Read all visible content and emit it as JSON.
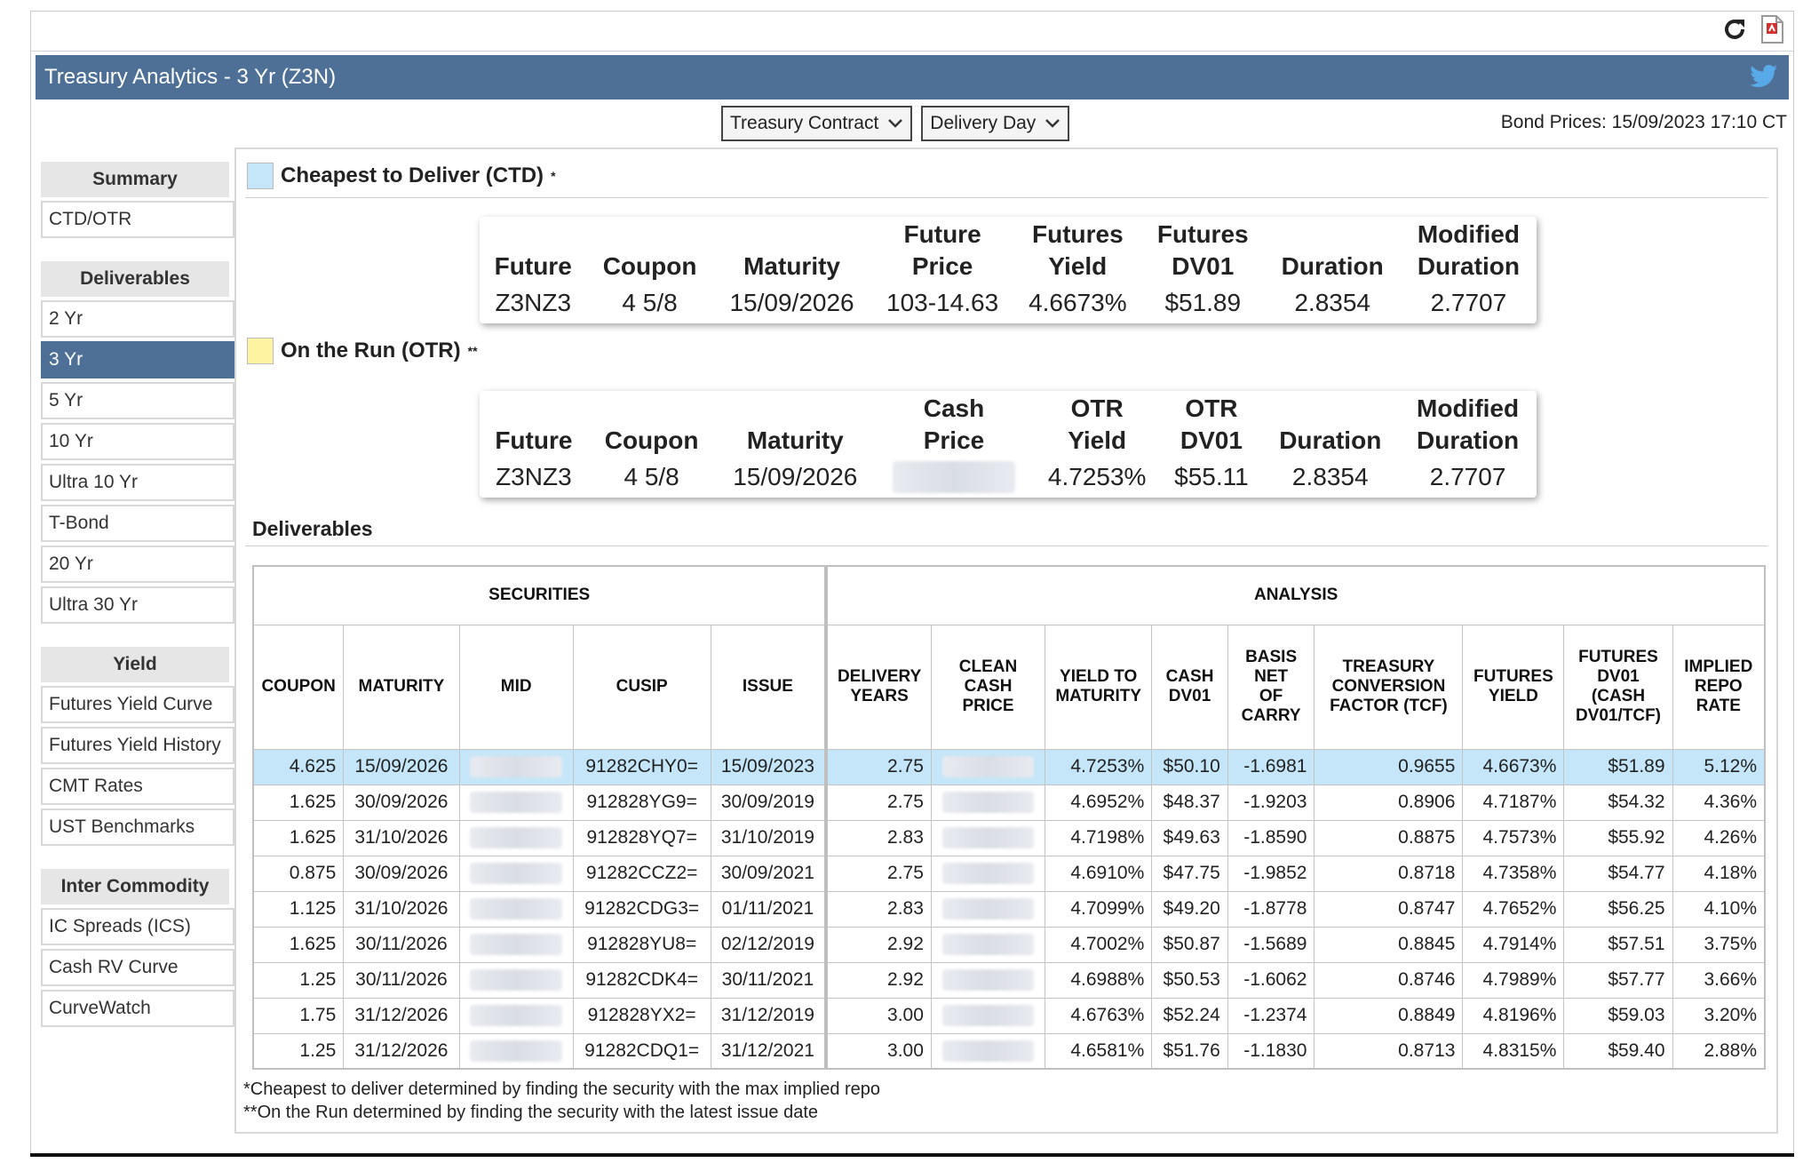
{
  "header": {
    "title": "Treasury Analytics - 3 Yr (Z3N)",
    "bond_prices": "Bond Prices: 15/09/2023 17:10 CT"
  },
  "icons": {
    "refresh": "refresh-icon",
    "pdf": "pdf-icon",
    "twitter": "twitter-icon",
    "twitter_color": "#58a9e8"
  },
  "controls": {
    "contract": "Treasury Contract",
    "delivery": "Delivery Day"
  },
  "colors": {
    "titlebar": "#4f7096",
    "ctd_swatch": "#c4e6f8",
    "otr_swatch": "#fdf3a0",
    "highlight_row": "#c4e6f8"
  },
  "sidebar": {
    "summary_head": "Summary",
    "summary_items": [
      "CTD/OTR"
    ],
    "deliverables_head": "Deliverables",
    "deliverables_items": [
      "2 Yr",
      "3 Yr",
      "5 Yr",
      "10 Yr",
      "Ultra 10 Yr",
      "T-Bond",
      "20 Yr",
      "Ultra 30 Yr"
    ],
    "active_item": "3 Yr",
    "yield_head": "Yield",
    "yield_items": [
      "Futures Yield Curve",
      "Futures Yield History",
      "CMT Rates",
      "UST Benchmarks"
    ],
    "inter_head": "Inter Commodity",
    "inter_items": [
      "IC Spreads (ICS)",
      "Cash RV Curve",
      "CurveWatch"
    ]
  },
  "ctd": {
    "heading": "Cheapest to Deliver (CTD)",
    "heading_mark": "*",
    "cols": [
      "Future",
      "Coupon",
      "Maturity",
      "Future Price",
      "Futures Yield",
      "Futures DV01",
      "Duration",
      "Modified Duration"
    ],
    "col_lines": [
      [
        "Future"
      ],
      [
        "Coupon"
      ],
      [
        "Maturity"
      ],
      [
        "Future",
        "Price"
      ],
      [
        "Futures",
        "Yield"
      ],
      [
        "Futures",
        "DV01"
      ],
      [
        "Duration"
      ],
      [
        "Modified",
        "Duration"
      ]
    ],
    "values": [
      "Z3NZ3",
      "4 5/8",
      "15/09/2026",
      "103-14.63",
      "4.6673%",
      "$51.89",
      "2.8354",
      "2.7707"
    ]
  },
  "otr": {
    "heading": "On the Run (OTR)",
    "heading_mark": "**",
    "col_lines": [
      [
        "Future"
      ],
      [
        "Coupon"
      ],
      [
        "Maturity"
      ],
      [
        "Cash",
        "Price"
      ],
      [
        "OTR",
        "Yield"
      ],
      [
        "OTR",
        "DV01"
      ],
      [
        "Duration"
      ],
      [
        "Modified",
        "Duration"
      ]
    ],
    "values": [
      "Z3NZ3",
      "4 5/8",
      "15/09/2026",
      "XXX.XXXX",
      "4.7253%",
      "$55.11",
      "2.8354",
      "2.7707"
    ],
    "masked_index": 3
  },
  "deliverables": {
    "title": "Deliverables",
    "group_securities": "SECURITIES",
    "group_analysis": "ANALYSIS",
    "headers": [
      [
        "COUPON"
      ],
      [
        "MATURITY"
      ],
      [
        "MID"
      ],
      [
        "CUSIP"
      ],
      [
        "ISSUE"
      ],
      [
        "DELIVERY",
        "YEARS"
      ],
      [
        "CLEAN",
        "CASH",
        "PRICE"
      ],
      [
        "YIELD TO",
        "MATURITY"
      ],
      [
        "CASH",
        "DV01"
      ],
      [
        "BASIS",
        "NET",
        "OF",
        "CARRY"
      ],
      [
        "TREASURY",
        "CONVERSION",
        "FACTOR (TCF)"
      ],
      [
        "FUTURES",
        "YIELD"
      ],
      [
        "FUTURES",
        "DV01",
        "(CASH",
        "DV01/TCF)"
      ],
      [
        "IMPLIED",
        "REPO",
        "RATE"
      ]
    ],
    "mask_text": "XXX.XXXX",
    "rows": [
      [
        "4.625",
        "15/09/2026",
        "XXX.XXXX",
        "91282CHY0=",
        "15/09/2023",
        "2.75",
        "XXX.XXXX",
        "4.7253%",
        "$50.10",
        "-1.6981",
        "0.9655",
        "4.6673%",
        "$51.89",
        "5.12%"
      ],
      [
        "1.625",
        "30/09/2026",
        "XXX.XXXX",
        "912828YG9=",
        "30/09/2019",
        "2.75",
        "XXX.XXXX",
        "4.6952%",
        "$48.37",
        "-1.9203",
        "0.8906",
        "4.7187%",
        "$54.32",
        "4.36%"
      ],
      [
        "1.625",
        "31/10/2026",
        "XXX.XXXX",
        "912828YQ7=",
        "31/10/2019",
        "2.83",
        "XXX.XXXX",
        "4.7198%",
        "$49.63",
        "-1.8590",
        "0.8875",
        "4.7573%",
        "$55.92",
        "4.26%"
      ],
      [
        "0.875",
        "30/09/2026",
        "XXX.XXXX",
        "91282CCZ2=",
        "30/09/2021",
        "2.75",
        "XXX.XXXX",
        "4.6910%",
        "$47.75",
        "-1.9852",
        "0.8718",
        "4.7358%",
        "$54.77",
        "4.18%"
      ],
      [
        "1.125",
        "31/10/2026",
        "XXX.XXXX",
        "91282CDG3=",
        "01/11/2021",
        "2.83",
        "XXX.XXXX",
        "4.7099%",
        "$49.20",
        "-1.8778",
        "0.8747",
        "4.7652%",
        "$56.25",
        "4.10%"
      ],
      [
        "1.625",
        "30/11/2026",
        "XXX.XXXX",
        "912828YU8=",
        "02/12/2019",
        "2.92",
        "XXX.XXXX",
        "4.7002%",
        "$50.87",
        "-1.5689",
        "0.8845",
        "4.7914%",
        "$57.51",
        "3.75%"
      ],
      [
        "1.25",
        "30/11/2026",
        "XXX.XXXX",
        "91282CDK4=",
        "30/11/2021",
        "2.92",
        "XXX.XXXX",
        "4.6988%",
        "$50.53",
        "-1.6062",
        "0.8746",
        "4.7989%",
        "$57.77",
        "3.66%"
      ],
      [
        "1.75",
        "31/12/2026",
        "XXX.XXXX",
        "912828YX2=",
        "31/12/2019",
        "3.00",
        "XXX.XXXX",
        "4.6763%",
        "$52.24",
        "-1.2374",
        "0.8849",
        "4.8196%",
        "$59.03",
        "3.20%"
      ],
      [
        "1.25",
        "31/12/2026",
        "XXX.XXXX",
        "91282CDQ1=",
        "31/12/2021",
        "3.00",
        "XXX.XXXX",
        "4.6581%",
        "$51.76",
        "-1.1830",
        "0.8713",
        "4.8315%",
        "$59.40",
        "2.88%"
      ]
    ],
    "highlight_row": 0
  },
  "footnotes": [
    "*Cheapest to deliver determined by finding the security with the max implied repo",
    "**On the Run determined by finding the security with the latest issue date"
  ]
}
